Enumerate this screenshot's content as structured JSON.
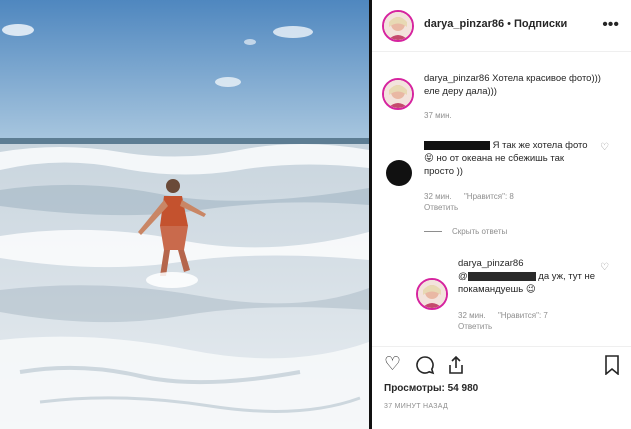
{
  "header": {
    "username": "darya_pinzar86",
    "separator": "•",
    "follow_label": "Подписки",
    "more_icon": "more-horizontal-icon"
  },
  "caption": {
    "username": "darya_pinzar86",
    "text": "Хотела красивое фото))) еле деру дала)))",
    "time": "37 мин."
  },
  "comment": {
    "text": "Я так же хотела фото😝 но от океана не сбежишь так просто ))",
    "time": "32 мин.",
    "likes": "\"Нравится\": 8",
    "reply": "Ответить"
  },
  "hide_replies": "Скрыть ответы",
  "reply": {
    "username": "darya_pinzar86",
    "mention": "@",
    "text": "да уж, тут не покамандуешь 😉",
    "time": "32 мин.",
    "likes": "\"Нравится\": 7",
    "reply": "Ответить"
  },
  "stats": {
    "views": "Просмотры: 54 980",
    "time_ago": "37 МИНУТ НАЗАД"
  },
  "colors": {
    "avatar_ring": "#d6249f",
    "muted_text": "#8e8e8e",
    "redaction": "#111111"
  }
}
